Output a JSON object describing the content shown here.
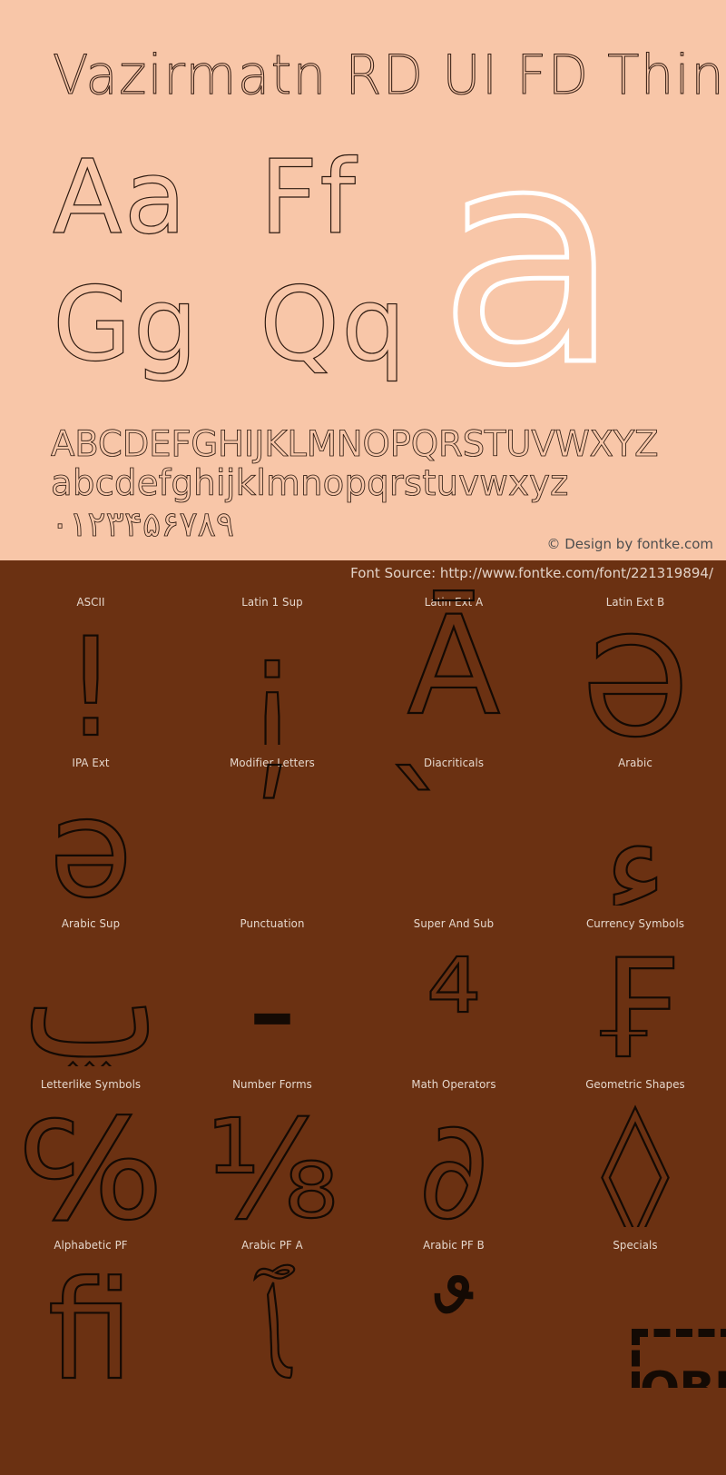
{
  "specimen": {
    "title": "Vazirmatn RD UI FD Thin",
    "letter_pairs": [
      "Aa",
      "Ff",
      "Gg",
      "Qq"
    ],
    "feature_letter": "a",
    "uppercase_row": "ABCDEFGHIJKLMNOPQRSTUVWXYZ",
    "lowercase_row": "abcdefghijklmnopqrstuvwxyz",
    "digits_row": "۰۱۲۳۴۵۶۷۸۹",
    "design_credit": "© Design by fontke.com",
    "background_color": "#f8c6a8",
    "text_color": "#2d1a10",
    "feature_letter_color": "#ffffff"
  },
  "source_bar": {
    "font_source": "Font Source: http://www.fontke.com/font/221319894/"
  },
  "glyph_grid": {
    "background_color": "#6b3112",
    "label_color": "#e6d8cd",
    "glyph_color": "#140a04",
    "cells": [
      {
        "label": "ASCII",
        "glyph": "!"
      },
      {
        "label": "Latin 1 Sup",
        "glyph": "¡"
      },
      {
        "label": "Latin Ext A",
        "glyph": "Ā"
      },
      {
        "label": "Latin Ext B",
        "glyph": "Ə"
      },
      {
        "label": "IPA Ext",
        "glyph": "ə"
      },
      {
        "label": "Modifier Letters",
        "glyph": "ʹ"
      },
      {
        "label": "Diacriticals",
        "glyph": "̀"
      },
      {
        "label": "Arabic",
        "glyph": "ء"
      },
      {
        "label": "Arabic Sup",
        "glyph": "ݐ"
      },
      {
        "label": "Punctuation",
        "glyph": "‐"
      },
      {
        "label": "Super And Sub",
        "glyph": "⁴"
      },
      {
        "label": "Currency Symbols",
        "glyph": "₣"
      },
      {
        "label": "Letterlike Symbols",
        "glyph": "℅"
      },
      {
        "label": "Number Forms",
        "glyph": "⅛"
      },
      {
        "label": "Math Operators",
        "glyph": "∂"
      },
      {
        "label": "Geometric Shapes",
        "glyph": "◊"
      },
      {
        "label": "Alphabetic PF",
        "glyph": "ﬁ"
      },
      {
        "label": "Arabic PF A",
        "glyph": "ﭑ"
      },
      {
        "label": "Arabic PF B",
        "glyph": "ﹲ"
      },
      {
        "label": "Specials",
        "glyph": "OBJ"
      }
    ]
  }
}
